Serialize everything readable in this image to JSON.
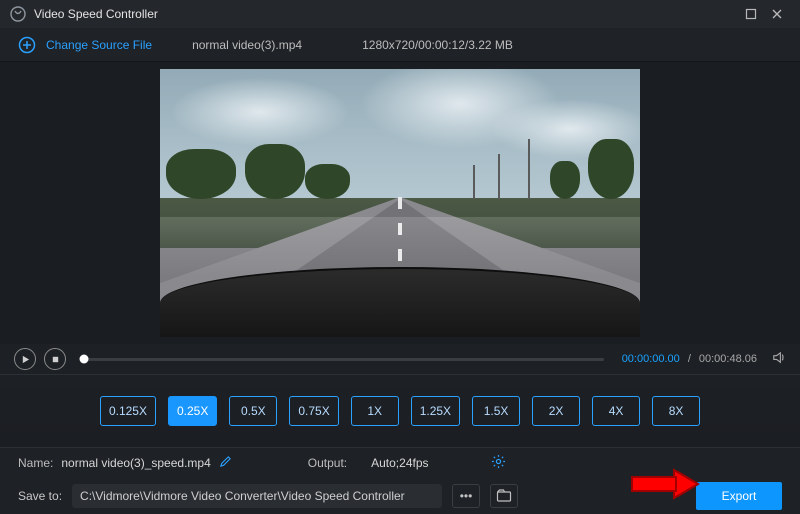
{
  "titlebar": {
    "title": "Video Speed Controller"
  },
  "source": {
    "change_label": "Change Source File",
    "file_name": "normal video(3).mp4",
    "meta": "1280x720/00:00:12/3.22 MB"
  },
  "player": {
    "current_time": "00:00:00.00",
    "total_time": "00:00:48.06"
  },
  "speed": {
    "options": [
      "0.125X",
      "0.25X",
      "0.5X",
      "0.75X",
      "1X",
      "1.25X",
      "1.5X",
      "2X",
      "4X",
      "8X"
    ],
    "selected": "0.25X"
  },
  "output": {
    "name_label": "Name:",
    "name_value": "normal video(3)_speed.mp4",
    "output_label": "Output:",
    "output_value": "Auto;24fps",
    "saveto_label": "Save to:",
    "saveto_path": "C:\\Vidmore\\Vidmore Video Converter\\Video Speed Controller",
    "export_label": "Export"
  }
}
